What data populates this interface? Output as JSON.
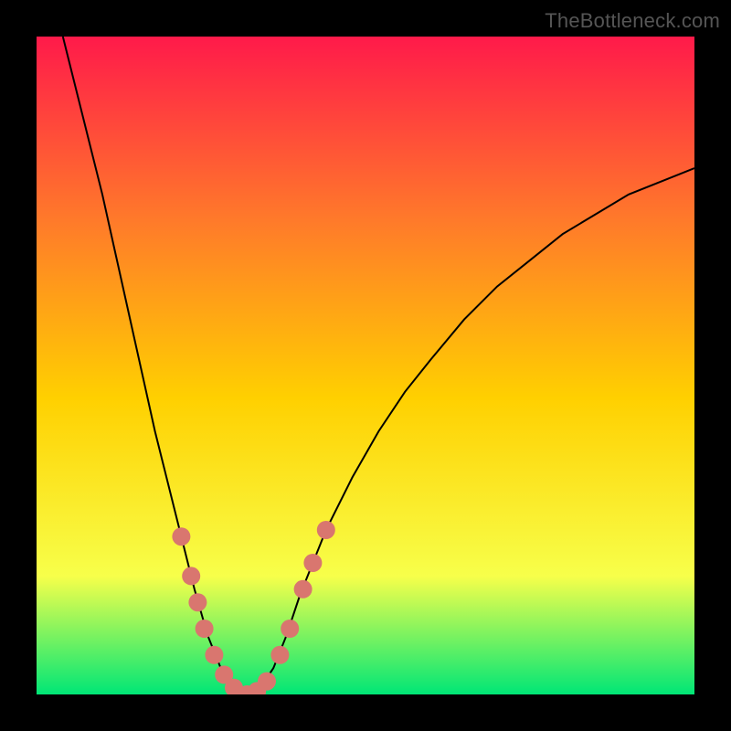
{
  "watermark": "TheBottleneck.com",
  "chart_data": {
    "type": "line",
    "title": "",
    "xlabel": "",
    "ylabel": "",
    "xlim": [
      0,
      100
    ],
    "ylim": [
      0,
      100
    ],
    "grid": false,
    "background_gradient": {
      "top": "#ff1a4a",
      "mid_top": "#ff7a2a",
      "mid": "#ffd000",
      "mid_bottom": "#f7ff4a",
      "bottom": "#00e676"
    },
    "curve_color": "#000000",
    "curve": [
      {
        "x": 4.0,
        "y": 100.0
      },
      {
        "x": 6.0,
        "y": 92.0
      },
      {
        "x": 8.0,
        "y": 84.0
      },
      {
        "x": 10.0,
        "y": 76.0
      },
      {
        "x": 12.0,
        "y": 67.0
      },
      {
        "x": 14.0,
        "y": 58.0
      },
      {
        "x": 16.0,
        "y": 49.0
      },
      {
        "x": 18.0,
        "y": 40.0
      },
      {
        "x": 20.0,
        "y": 32.0
      },
      {
        "x": 22.0,
        "y": 24.0
      },
      {
        "x": 24.0,
        "y": 16.0
      },
      {
        "x": 26.0,
        "y": 9.0
      },
      {
        "x": 28.0,
        "y": 4.0
      },
      {
        "x": 30.0,
        "y": 1.0
      },
      {
        "x": 32.0,
        "y": 0.0
      },
      {
        "x": 34.0,
        "y": 1.0
      },
      {
        "x": 36.0,
        "y": 4.0
      },
      {
        "x": 38.0,
        "y": 9.0
      },
      {
        "x": 40.0,
        "y": 15.0
      },
      {
        "x": 44.0,
        "y": 25.0
      },
      {
        "x": 48.0,
        "y": 33.0
      },
      {
        "x": 52.0,
        "y": 40.0
      },
      {
        "x": 56.0,
        "y": 46.0
      },
      {
        "x": 60.0,
        "y": 51.0
      },
      {
        "x": 65.0,
        "y": 57.0
      },
      {
        "x": 70.0,
        "y": 62.0
      },
      {
        "x": 75.0,
        "y": 66.0
      },
      {
        "x": 80.0,
        "y": 70.0
      },
      {
        "x": 85.0,
        "y": 73.0
      },
      {
        "x": 90.0,
        "y": 76.0
      },
      {
        "x": 95.0,
        "y": 78.0
      },
      {
        "x": 100.0,
        "y": 80.0
      }
    ],
    "markers": {
      "color": "#d9766f",
      "radius": 10,
      "points": [
        {
          "x": 22.0,
          "y": 24.0
        },
        {
          "x": 23.5,
          "y": 18.0
        },
        {
          "x": 24.5,
          "y": 14.0
        },
        {
          "x": 25.5,
          "y": 10.0
        },
        {
          "x": 27.0,
          "y": 6.0
        },
        {
          "x": 28.5,
          "y": 3.0
        },
        {
          "x": 30.0,
          "y": 1.0
        },
        {
          "x": 32.0,
          "y": 0.0
        },
        {
          "x": 33.5,
          "y": 0.5
        },
        {
          "x": 35.0,
          "y": 2.0
        },
        {
          "x": 37.0,
          "y": 6.0
        },
        {
          "x": 38.5,
          "y": 10.0
        },
        {
          "x": 40.5,
          "y": 16.0
        },
        {
          "x": 42.0,
          "y": 20.0
        },
        {
          "x": 44.0,
          "y": 25.0
        }
      ]
    }
  }
}
